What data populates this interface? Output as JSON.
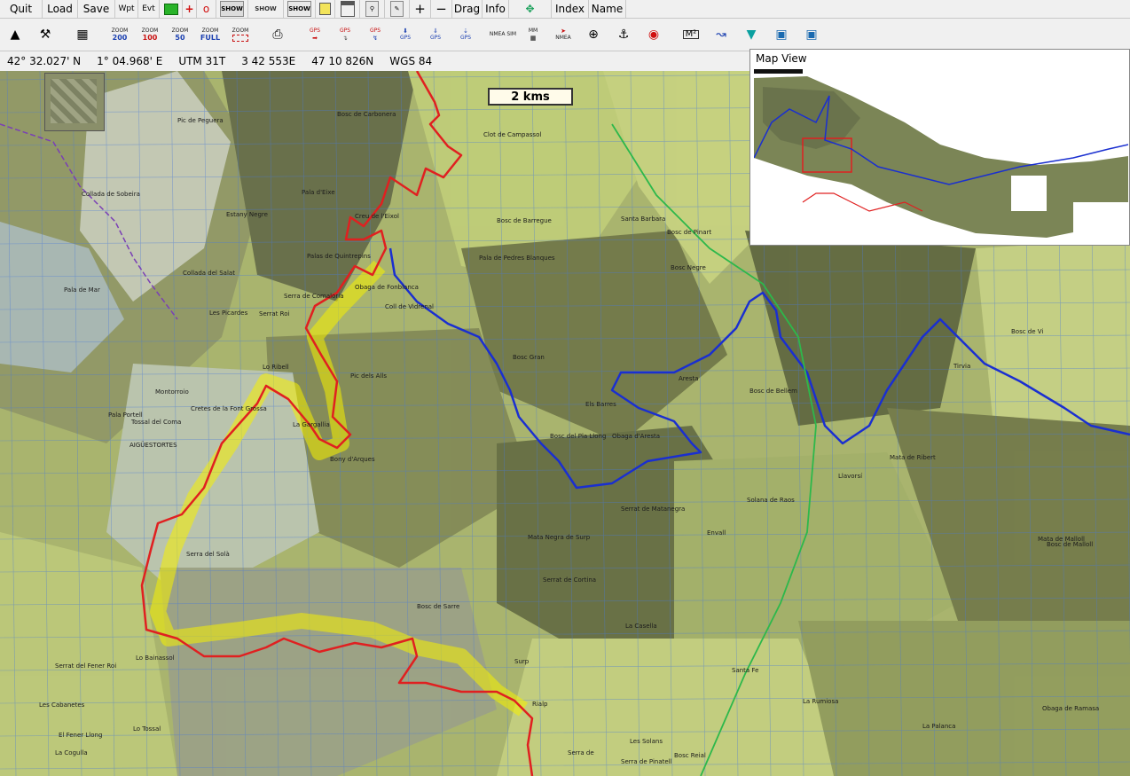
{
  "menu": {
    "quit": "Quit",
    "load": "Load",
    "save": "Save",
    "wpt": "Wpt",
    "evt": "Evt",
    "plus": "+",
    "circle": "o",
    "show1": "SHOW",
    "show2": "SHOW",
    "show3": "SHOW",
    "drag": "Drag",
    "info": "Info",
    "index": "Index",
    "name": "Name",
    "zoom_plus": "+",
    "zoom_minus": "−"
  },
  "zoom_buttons": [
    {
      "label": "ZOOM",
      "value": "200",
      "color": "blue"
    },
    {
      "label": "ZOOM",
      "value": "100",
      "color": "red"
    },
    {
      "label": "ZOOM",
      "value": "50",
      "color": "blue"
    },
    {
      "label": "ZOOM",
      "value": "FULL",
      "color": "blue"
    },
    {
      "label": "ZOOM",
      "value": "",
      "color": "red"
    }
  ],
  "gps_buttons": [
    "GPS",
    "GPS",
    "GPS",
    "GPS",
    "GPS",
    "GPS"
  ],
  "nmea_sim": "NMEA SIM",
  "mm_label": "MM",
  "nmea": "NMEA",
  "status": {
    "lat": "42° 32.027' N",
    "lon": "1° 04.968' E",
    "utm": "UTM  31T",
    "easting": "3 42 553E",
    "northing": "47 10 826N",
    "datum": "WGS 84"
  },
  "scale_label": "2 kms",
  "mapview": {
    "title": "Map View"
  },
  "map_labels": [
    {
      "text": "Bosc de Carbonera"
    },
    {
      "text": "Clot de Campassol"
    },
    {
      "text": "Pic de Peguera"
    },
    {
      "text": "Pala d'Eixe"
    },
    {
      "text": "Creu de l'Eixol"
    },
    {
      "text": "Palas de Quintrepins"
    },
    {
      "text": "Serra de Comaloria"
    },
    {
      "text": "Obaga de Fonblanca"
    },
    {
      "text": "Serrat Roi"
    },
    {
      "text": "Lo Ribell"
    },
    {
      "text": "Pic dels Alls"
    },
    {
      "text": "Coll de Vidrenal"
    },
    {
      "text": "Bosc de Barregue"
    },
    {
      "text": "Pala de Pedres Blanques"
    },
    {
      "text": "Bosc Negre"
    },
    {
      "text": "Santa Barbara"
    },
    {
      "text": "Bosc de Pinart"
    },
    {
      "text": "Bosc Gran"
    },
    {
      "text": "Els Barres"
    },
    {
      "text": "Obaga d'Aresta"
    },
    {
      "text": "Bosc del Pla Llong"
    },
    {
      "text": "Serrat de Matanegra"
    },
    {
      "text": "Solana de Raos"
    },
    {
      "text": "Envall"
    },
    {
      "text": "Bosc de Bellem"
    },
    {
      "text": "Aresta"
    },
    {
      "text": "Mata de Ribert"
    },
    {
      "text": "Bosc de Vi"
    },
    {
      "text": "Tirvia"
    },
    {
      "text": "Llavorsí"
    },
    {
      "text": "La Gargallia"
    },
    {
      "text": "Bony d'Arques"
    },
    {
      "text": "Cretes de la Font Grossa"
    },
    {
      "text": "Montorroio"
    },
    {
      "text": "Pala Portell"
    },
    {
      "text": "Tossal del Coma"
    },
    {
      "text": "AIGÜESTORTES"
    },
    {
      "text": "Serra del Solà"
    },
    {
      "text": "Mata Negra de Surp"
    },
    {
      "text": "Serrat de Cortina"
    },
    {
      "text": "Bosc de Sarre"
    },
    {
      "text": "Surp"
    },
    {
      "text": "La Casella"
    },
    {
      "text": "Santa Fe"
    },
    {
      "text": "Bosc Reial"
    },
    {
      "text": "La Rumiosa"
    },
    {
      "text": "La Palanca"
    },
    {
      "text": "Obaga de Ramasa"
    },
    {
      "text": "Serrat del Fener Roi"
    },
    {
      "text": "Lo Bainassol"
    },
    {
      "text": "Les Cabanetes"
    },
    {
      "text": "El Fener Llong"
    },
    {
      "text": "Lo Tossal"
    },
    {
      "text": "La Cogulla"
    },
    {
      "text": "Rialp"
    },
    {
      "text": "Serra de"
    },
    {
      "text": "Bosc de Malloll"
    },
    {
      "text": "Mata de Malloll"
    },
    {
      "text": "Les Solans"
    },
    {
      "text": "Serra de Pinatell"
    },
    {
      "text": "Estany Negre"
    },
    {
      "text": "Pala de Mar"
    },
    {
      "text": "Collada de Sobeira"
    },
    {
      "text": "Les Picardes"
    },
    {
      "text": "Collada del Salat"
    }
  ],
  "colors": {
    "menu_bg": "#f0f0f0",
    "map_base": "#a8b06a",
    "route_red": "#e02020",
    "route_blue": "#1a2fd0",
    "highlight_yellow": "#f5f000"
  }
}
